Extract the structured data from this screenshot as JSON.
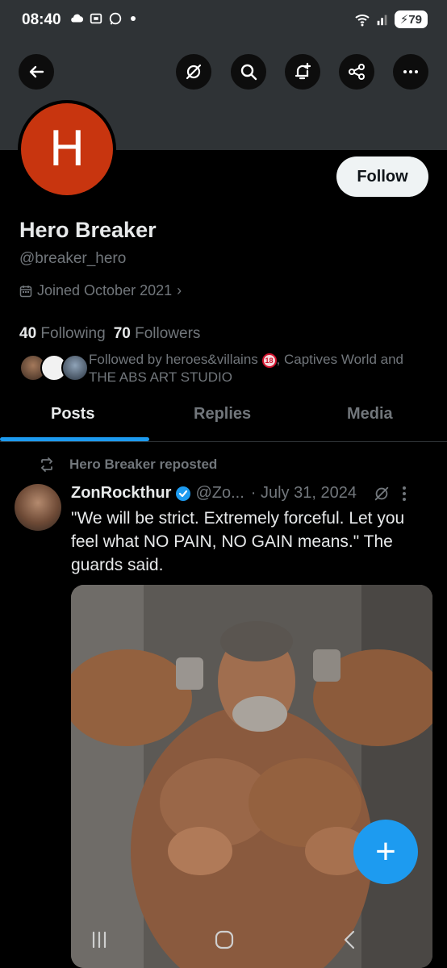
{
  "status_bar": {
    "time": "08:40",
    "battery": "79"
  },
  "profile": {
    "avatar_letter": "H",
    "name": "Hero Breaker",
    "handle": "@breaker_hero",
    "joined": "Joined October 2021",
    "following_count": "40",
    "following_label": "Following",
    "followers_count": "70",
    "followers_label": "Followers",
    "followed_by_prefix": "Followed by heroes&villains",
    "followed_by_suffix": ", Captives World and THE ABS ART STUDIO",
    "follow_label": "Follow"
  },
  "tabs": [
    "Posts",
    "Replies",
    "Media"
  ],
  "post": {
    "repost_label": "Hero Breaker reposted",
    "author_name": "ZonRockthur",
    "author_handle": "@Zo...",
    "date": "· July 31, 2024",
    "text": "\"We will be strict. Extremely forceful. Let you feel what NO PAIN, NO GAIN means.\" The guards said."
  },
  "fab_label": "+",
  "colors": {
    "accent": "#1d9bf0",
    "avatar_bg": "#c8350f",
    "background": "#000000"
  }
}
